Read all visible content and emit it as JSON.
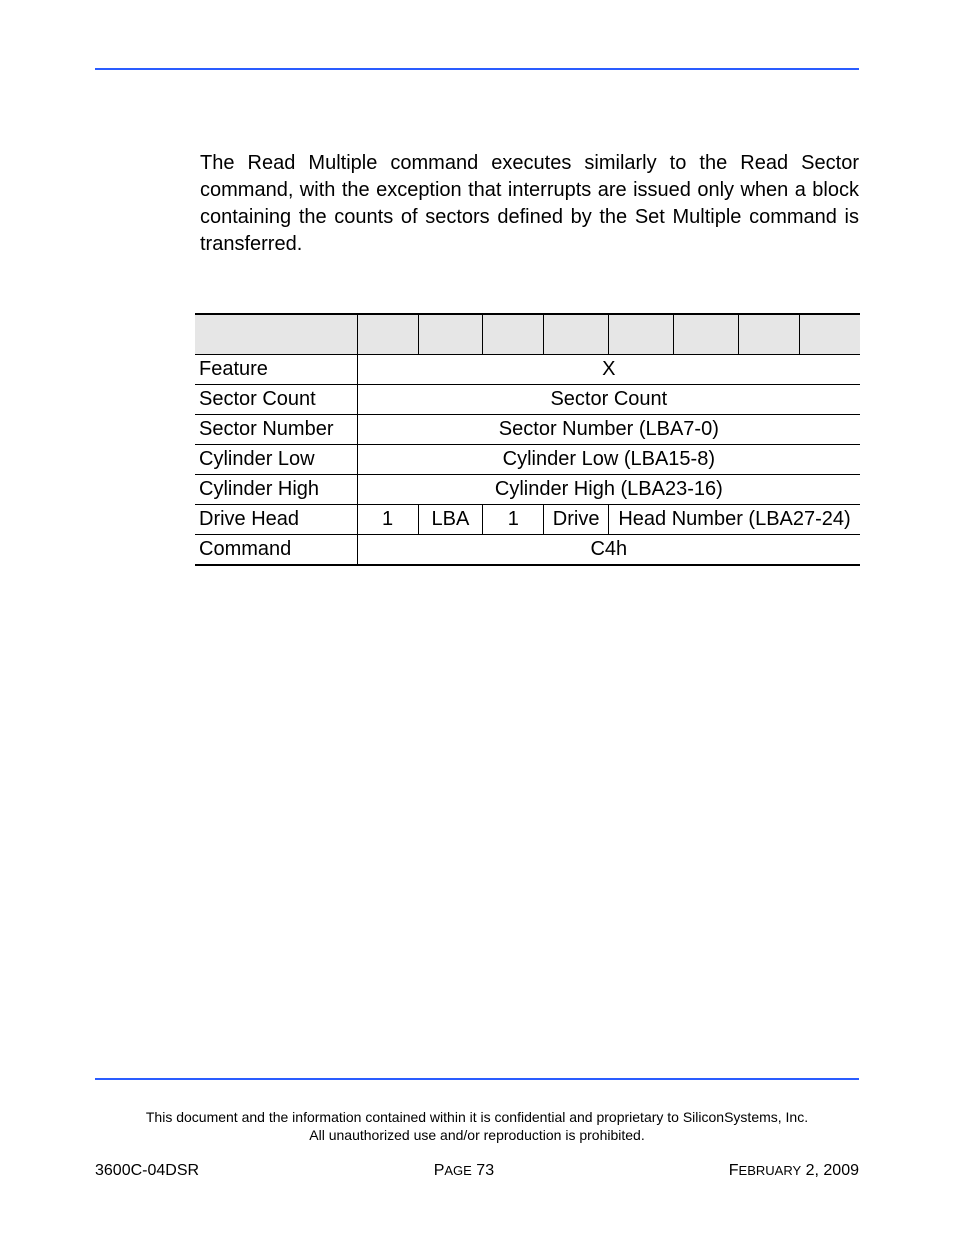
{
  "body": {
    "paragraph": "The Read Multiple command executes similarly to the Read Sector command, with the exception that interrupts are issued only when a block containing the counts of sectors defined by the Set Multiple command is transferred."
  },
  "table": {
    "rows": {
      "feature": {
        "label": "Feature",
        "value": "X"
      },
      "sector_count": {
        "label": "Sector Count",
        "value": "Sector Count"
      },
      "sector_number": {
        "label": "Sector Number",
        "value": "Sector Number (LBA7-0)"
      },
      "cylinder_low": {
        "label": "Cylinder Low",
        "value": "Cylinder Low (LBA15-8)"
      },
      "cylinder_high": {
        "label": "Cylinder High",
        "value": "Cylinder High (LBA23-16)"
      },
      "drive_head": {
        "label": "Drive Head",
        "b7": "1",
        "b6": "LBA",
        "b5": "1",
        "b4": "Drive",
        "b3_0": "Head Number (LBA27-24)"
      },
      "command": {
        "label": "Command",
        "value": "C4h"
      }
    }
  },
  "footer": {
    "disclaimer1": "This document and the information contained within it is confidential and proprietary to SiliconSystems, Inc.",
    "disclaimer2": "All unauthorized use and/or reproduction is prohibited.",
    "left": "3600C-04DSR",
    "center_prefix": "P",
    "center_word": "AGE",
    "center_num": " 73",
    "right_prefix": "F",
    "right_word": "EBRUARY",
    "right_rest": " 2, 2009"
  }
}
